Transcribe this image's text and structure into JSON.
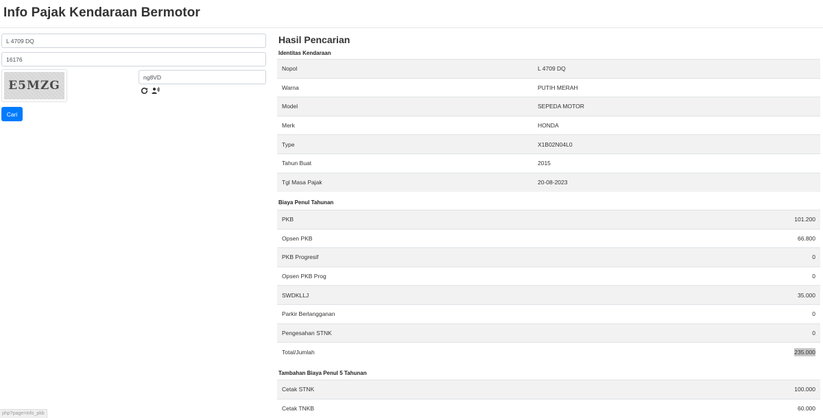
{
  "page": {
    "title": "Info Pajak Kendaraan Bermotor"
  },
  "form": {
    "nopol_value": "L 4709 DQ",
    "kode_value": "16176",
    "captcha_image_text": "E5MZG",
    "captcha_input_value": "ng8VD",
    "refresh_icon": "refresh-icon",
    "audio_icon": "speaker-icon",
    "submit_label": "Cari"
  },
  "status_bar": {
    "url": "php?page=info_pkb"
  },
  "result": {
    "title": "Hasil Pencarian",
    "identitas": {
      "heading": "Identitas Kendaraan",
      "rows": [
        {
          "label": "Nopol",
          "value": "L 4709 DQ"
        },
        {
          "label": "Warna",
          "value": "PUTIH MERAH"
        },
        {
          "label": "Model",
          "value": "SEPEDA MOTOR"
        },
        {
          "label": "Merk",
          "value": "HONDA"
        },
        {
          "label": "Type",
          "value": "X1B02N04L0"
        },
        {
          "label": "Tahun Buat",
          "value": "2015"
        },
        {
          "label": "Tgl Masa Pajak",
          "value": "20-08-2023"
        }
      ]
    },
    "biaya": {
      "heading": "Biaya Penul Tahunan",
      "rows": [
        {
          "label": "PKB",
          "value": "101.200"
        },
        {
          "label": "Opsen PKB",
          "value": "66.800"
        },
        {
          "label": "PKB Progresif",
          "value": "0"
        },
        {
          "label": "Opsen PKB Prog",
          "value": "0"
        },
        {
          "label": "SWDKLLJ",
          "value": "35.000"
        },
        {
          "label": "Parkir Berlangganan",
          "value": "0"
        },
        {
          "label": "Pengesahan STNK",
          "value": "0"
        },
        {
          "label": "Total/Jumlah",
          "value": "235.000"
        }
      ]
    },
    "tambahan": {
      "heading": "Tambahan Biaya Penul 5 Tahunan",
      "rows": [
        {
          "label": "Cetak STNK",
          "value": "100.000"
        },
        {
          "label": "Cetak TNKB",
          "value": "60.000"
        }
      ]
    }
  }
}
